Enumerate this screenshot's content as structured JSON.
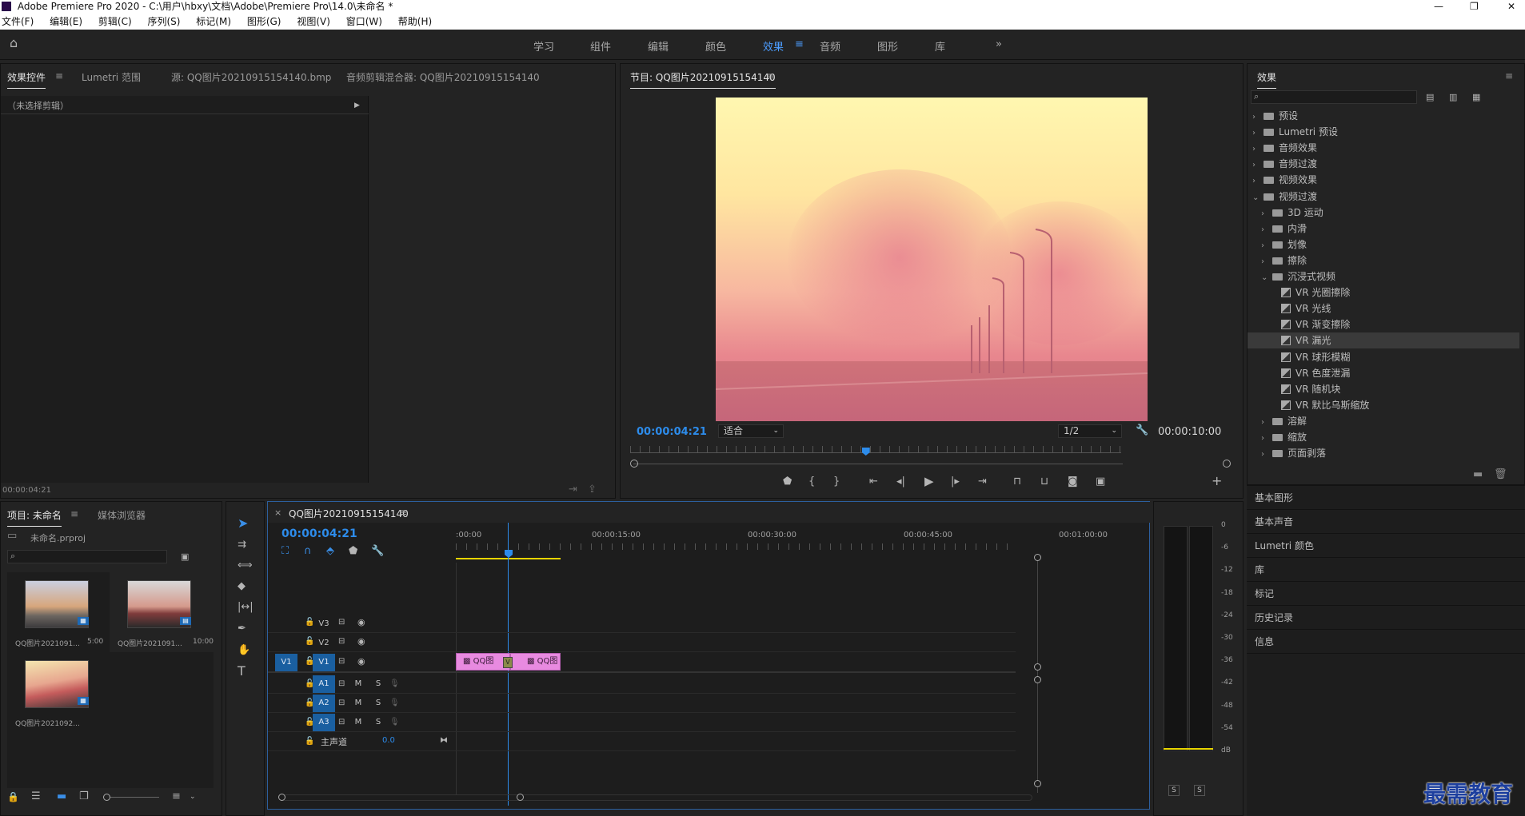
{
  "window": {
    "title": "Adobe Premiere Pro 2020 - C:\\用户\\hbxy\\文档\\Adobe\\Premiere Pro\\14.0\\未命名 *"
  },
  "menu": [
    "文件(F)",
    "编辑(E)",
    "剪辑(C)",
    "序列(S)",
    "标记(M)",
    "图形(G)",
    "视图(V)",
    "窗口(W)",
    "帮助(H)"
  ],
  "workspaces": [
    "学习",
    "组件",
    "编辑",
    "颜色",
    "效果",
    "音频",
    "图形",
    "库"
  ],
  "active_workspace": "效果",
  "source_panel": {
    "tabs": [
      "效果控件",
      "Lumetri 范围",
      "源: QQ图片20210915154140.bmp",
      "音频剪辑混合器: QQ图片20210915154140"
    ],
    "no_clip": "（未选择剪辑）",
    "timecode": "00:00:04:21"
  },
  "program": {
    "title": "节目: QQ图片20210915154140",
    "timecode": "00:00:04:21",
    "fit": "适合",
    "quality": "1/2",
    "duration": "00:00:10:00",
    "playhead_fraction": 0.48
  },
  "effects": {
    "title": "效果",
    "items": [
      {
        "label": "预设",
        "level": 0,
        "kind": "folder",
        "open": false
      },
      {
        "label": "Lumetri 预设",
        "level": 0,
        "kind": "folder",
        "open": false
      },
      {
        "label": "音频效果",
        "level": 0,
        "kind": "folder",
        "open": false
      },
      {
        "label": "音频过渡",
        "level": 0,
        "kind": "folder",
        "open": false
      },
      {
        "label": "视频效果",
        "level": 0,
        "kind": "folder",
        "open": false
      },
      {
        "label": "视频过渡",
        "level": 0,
        "kind": "folder",
        "open": true
      },
      {
        "label": "3D 运动",
        "level": 1,
        "kind": "folder",
        "open": false
      },
      {
        "label": "内滑",
        "level": 1,
        "kind": "folder",
        "open": false
      },
      {
        "label": "划像",
        "level": 1,
        "kind": "folder",
        "open": false
      },
      {
        "label": "擦除",
        "level": 1,
        "kind": "folder",
        "open": false
      },
      {
        "label": "沉浸式视频",
        "level": 1,
        "kind": "folder",
        "open": true
      },
      {
        "label": "VR 光圈擦除",
        "level": 2,
        "kind": "fx"
      },
      {
        "label": "VR 光线",
        "level": 2,
        "kind": "fx"
      },
      {
        "label": "VR 渐变擦除",
        "level": 2,
        "kind": "fx"
      },
      {
        "label": "VR 漏光",
        "level": 2,
        "kind": "fx",
        "selected": true
      },
      {
        "label": "VR 球形模糊",
        "level": 2,
        "kind": "fx"
      },
      {
        "label": "VR 色度泄漏",
        "level": 2,
        "kind": "fx"
      },
      {
        "label": "VR 随机块",
        "level": 2,
        "kind": "fx"
      },
      {
        "label": "VR 默比乌斯缩放",
        "level": 2,
        "kind": "fx"
      },
      {
        "label": "溶解",
        "level": 1,
        "kind": "folder",
        "open": false
      },
      {
        "label": "缩放",
        "level": 1,
        "kind": "folder",
        "open": false
      },
      {
        "label": "页面剥落",
        "level": 1,
        "kind": "folder",
        "open": false
      }
    ],
    "sections": [
      "基本图形",
      "基本声音",
      "Lumetri 颜色",
      "库",
      "标记",
      "历史记录",
      "信息"
    ]
  },
  "project": {
    "tabs": [
      "项目: 未命名",
      "媒体浏览器"
    ],
    "file": "未命名.prproj",
    "items": [
      {
        "name": "QQ图片2021091...",
        "duration": "5:00"
      },
      {
        "name": "QQ图片2021091...",
        "duration": "10:00"
      },
      {
        "name": "QQ图片2021092...",
        "duration": ""
      }
    ]
  },
  "timeline": {
    "title": "QQ图片20210915154140",
    "timecode": "00:00:04:21",
    "ruler": [
      ":00:00",
      "00:00:15:00",
      "00:00:30:00",
      "00:00:45:00",
      "00:01:00:00"
    ],
    "video_tracks": [
      "V3",
      "V2",
      "V1"
    ],
    "audio_tracks": [
      "A1",
      "A2",
      "A3"
    ],
    "src_track": "V1",
    "master": "主声道",
    "master_value": "0.0",
    "clip1": "QQ图",
    "clip2": "QQ图",
    "transition_label": "V",
    "mute_label": "M",
    "solo_label": "S"
  },
  "meter": {
    "ticks": [
      "0",
      "-6",
      "-12",
      "-18",
      "-24",
      "-30",
      "-36",
      "-42",
      "-48",
      "-54",
      "dB"
    ],
    "solo": [
      "S",
      "S"
    ]
  },
  "watermark": "最需教育",
  "colors": {
    "accent": "#2d8ceb",
    "clip": "#e88ae0",
    "track_active": "#1a5fa0",
    "yellow_bar": "#e7d400"
  }
}
